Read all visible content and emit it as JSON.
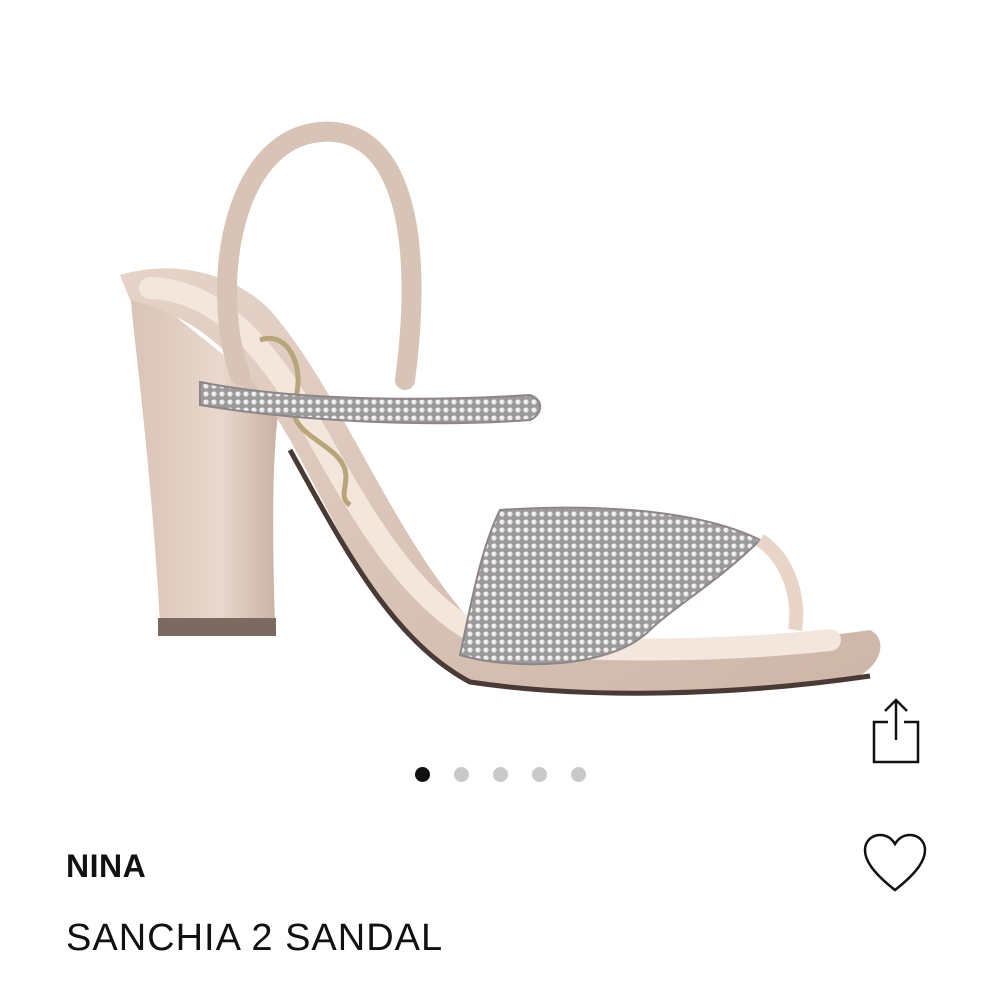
{
  "product": {
    "brand": "NINA",
    "name": "SANCHIA 2 SANDAL"
  },
  "gallery": {
    "image_count": 5,
    "active_index": 0
  },
  "icons": {
    "share": "share-icon",
    "favorite": "heart-icon"
  },
  "colors": {
    "active_dot": "#111111",
    "inactive_dot": "#c9c9c9",
    "text": "#111111"
  }
}
